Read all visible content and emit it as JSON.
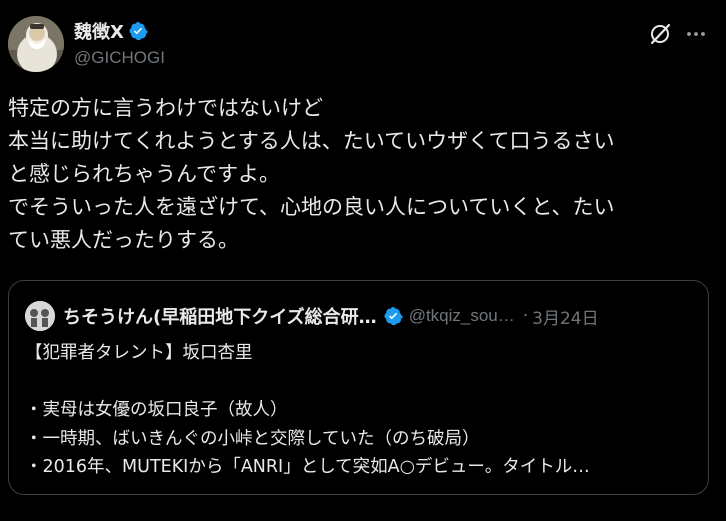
{
  "author": {
    "display_name": "魏徴X",
    "handle": "@GICHOGI",
    "verified_color": "#1d9bf0"
  },
  "actions": {
    "grok_icon": "grok-icon",
    "more_icon": "more-horizontal-icon"
  },
  "tweet": {
    "lines": [
      "特定の方に言うわけではないけど",
      "本当に助けてくれようとする人は、たいていウザくて口うるさい",
      "と感じられちゃうんですよ。",
      "でそういった人を遠ざけて、心地の良い人についていくと、たい",
      "てい悪人だったりする。"
    ]
  },
  "quote": {
    "display_name": "ちそうけん(早稲田地下クイズ総合研…",
    "handle": "@tkqiz_sou…",
    "separator": "·",
    "date": "3月24日",
    "lines": [
      "【犯罪者タレント】坂口杏里",
      "",
      "・実母は女優の坂口良子（故人）",
      "・一時期、ばいきんぐの小峠と交際していた（のち破局）",
      "・2016年、MUTEKIから「ANRI」として突如A○デビュー。タイトル…"
    ]
  },
  "colors": {
    "background": "#000000",
    "text": "#e7e9ea",
    "muted": "#71767b",
    "border": "#3a3e42",
    "accent": "#1d9bf0"
  }
}
